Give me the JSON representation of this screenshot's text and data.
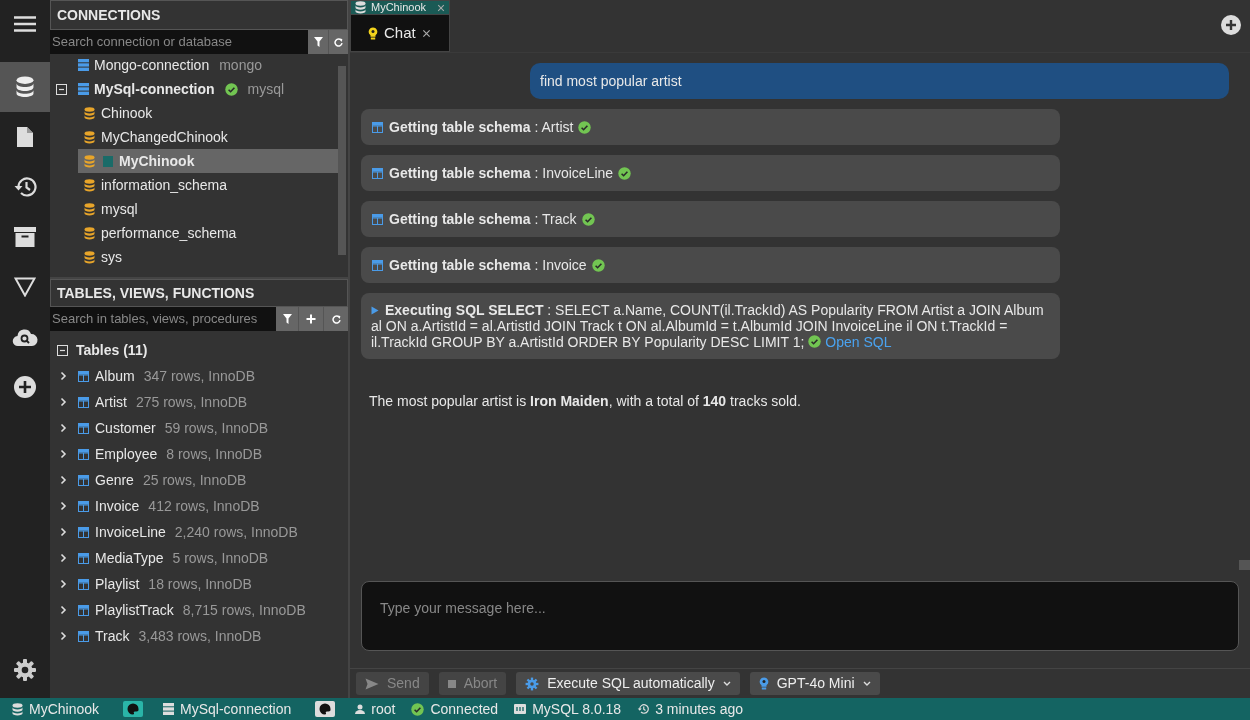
{
  "activity_bar": {
    "items": [
      {
        "selected": false
      },
      {
        "selected": true
      },
      {
        "selected": false
      },
      {
        "selected": false
      },
      {
        "selected": false
      },
      {
        "selected": false
      },
      {
        "selected": false
      },
      {
        "selected": false
      },
      {
        "selected": false
      }
    ]
  },
  "connections": {
    "title": "CONNECTIONS",
    "search": {
      "placeholder": "Search connection or database"
    },
    "tree": [
      {
        "name": "Mongo-connection",
        "engine": "mongo",
        "expanded": false,
        "connected": false
      },
      {
        "name": "MySql-connection",
        "engine": "mysql",
        "expanded": true,
        "connected": true,
        "children": [
          {
            "name": "Chinook",
            "selected": false
          },
          {
            "name": "MyChangedChinook",
            "selected": false
          },
          {
            "name": "MyChinook",
            "selected": true,
            "color": "#1a6b68"
          },
          {
            "name": "information_schema",
            "selected": false
          },
          {
            "name": "mysql",
            "selected": false
          },
          {
            "name": "performance_schema",
            "selected": false
          },
          {
            "name": "sys",
            "selected": false
          }
        ]
      }
    ]
  },
  "objects": {
    "title": "TABLES, VIEWS, FUNCTIONS",
    "search": {
      "placeholder": "Search in tables, views, procedures"
    },
    "group": {
      "label": "Tables (11)",
      "expanded": true
    },
    "tables": [
      {
        "name": "Album",
        "info": "347 rows, InnoDB"
      },
      {
        "name": "Artist",
        "info": "275 rows, InnoDB"
      },
      {
        "name": "Customer",
        "info": "59 rows, InnoDB"
      },
      {
        "name": "Employee",
        "info": "8 rows, InnoDB"
      },
      {
        "name": "Genre",
        "info": "25 rows, InnoDB"
      },
      {
        "name": "Invoice",
        "info": "412 rows, InnoDB"
      },
      {
        "name": "InvoiceLine",
        "info": "2,240 rows, InnoDB"
      },
      {
        "name": "MediaType",
        "info": "5 rows, InnoDB"
      },
      {
        "name": "Playlist",
        "info": "18 rows, InnoDB"
      },
      {
        "name": "PlaylistTrack",
        "info": "8,715 rows, InnoDB"
      },
      {
        "name": "Track",
        "info": "3,483 rows, InnoDB"
      }
    ]
  },
  "tabs": {
    "database": "MyChinook",
    "items": [
      {
        "label": "Chat",
        "selected": true
      }
    ]
  },
  "chat": {
    "messages": [
      {
        "kind": "user",
        "text": "find most popular artist"
      },
      {
        "kind": "schema",
        "text": "**Getting table schema** : Artist",
        "done": true
      },
      {
        "kind": "schema",
        "text": "**Getting table schema** : InvoiceLine",
        "done": true
      },
      {
        "kind": "schema",
        "text": "**Getting table schema** : Track",
        "done": true
      },
      {
        "kind": "schema",
        "text": "**Getting table schema** : Invoice",
        "done": true
      },
      {
        "kind": "sql",
        "text": "**Executing SQL SELECT** : SELECT a.Name, COUNT(il.TrackId) AS Popularity FROM Artist a JOIN Album al ON a.ArtistId = al.ArtistId JOIN Track t ON al.AlbumId = t.AlbumId JOIN InvoiceLine il ON t.TrackId = il.TrackId GROUP BY a.ArtistId ORDER BY Popularity DESC LIMIT 1;",
        "done": true,
        "link": "Open SQL"
      },
      {
        "kind": "answer",
        "text": "The most popular artist is **Iron Maiden**, with a total of **140** tracks sold."
      }
    ],
    "input": {
      "placeholder": "Type your message here..."
    },
    "toolbar": [
      {
        "kind": "send",
        "label": "Send",
        "disabled": true
      },
      {
        "kind": "abort",
        "label": "Abort",
        "disabled": true
      },
      {
        "kind": "mode",
        "label": "Execute SQL automatically",
        "disabled": false
      },
      {
        "kind": "model",
        "label": "GPT-4o Mini",
        "disabled": false
      }
    ]
  },
  "status_bar": [
    {
      "kind": "database",
      "text": "MyChinook"
    },
    {
      "kind": "palette"
    },
    {
      "kind": "server",
      "text": "MySql-connection"
    },
    {
      "kind": "palette-light"
    },
    {
      "kind": "user",
      "text": "root"
    },
    {
      "kind": "connected",
      "text": "Connected"
    },
    {
      "kind": "version",
      "text": "MySQL 8.0.18"
    },
    {
      "kind": "time",
      "text": "3 minutes ago"
    }
  ]
}
